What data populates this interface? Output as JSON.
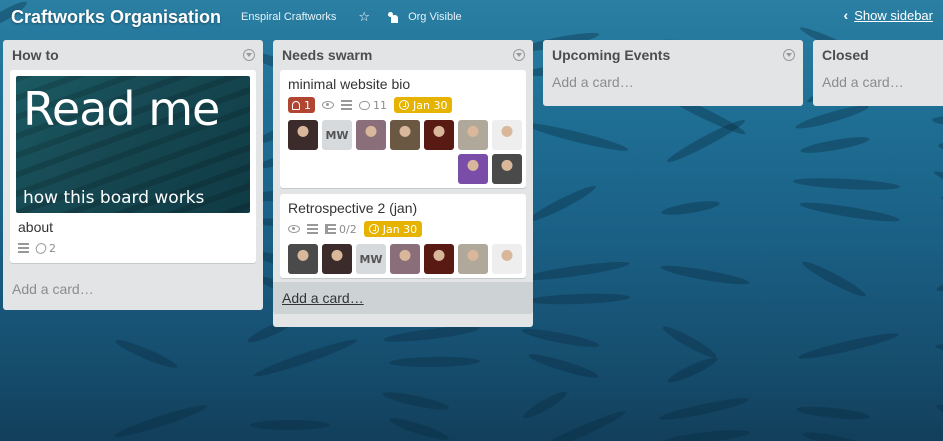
{
  "board": {
    "title": "Craftworks Organisation",
    "org": "Enspiral Craftworks",
    "visibility": "Org Visible",
    "show_sidebar": "Show sidebar"
  },
  "lists": [
    {
      "title": "How to",
      "cards": [
        {
          "cover_title": "Read me",
          "cover_subtitle": "how this board works",
          "title": "about",
          "attachments": "2"
        }
      ],
      "add_card": "Add a card…"
    },
    {
      "title": "Needs swarm",
      "cards": [
        {
          "title": "minimal website bio",
          "notifications": "1",
          "comments": "11",
          "due": "Jan 30",
          "members": [
            {
              "type": "photo",
              "color": "#3b2b2b"
            },
            {
              "type": "initials",
              "initials": "MW"
            },
            {
              "type": "photo",
              "color": "#8a6f7a"
            },
            {
              "type": "photo",
              "color": "#6b5842"
            },
            {
              "type": "photo",
              "color": "#5a1a14"
            },
            {
              "type": "photo",
              "color": "#b0a89a"
            },
            {
              "type": "photo",
              "color": "#eeeeee"
            },
            {
              "type": "photo",
              "color": "#7a4ea8"
            },
            {
              "type": "photo",
              "color": "#4a4a4a"
            }
          ]
        },
        {
          "title": "Retrospective 2 (jan)",
          "checklist": "0/2",
          "due": "Jan 30",
          "members": [
            {
              "type": "photo",
              "color": "#4a4a4a"
            },
            {
              "type": "photo",
              "color": "#3b2b2b"
            },
            {
              "type": "initials",
              "initials": "MW"
            },
            {
              "type": "photo",
              "color": "#8a6f7a"
            },
            {
              "type": "photo",
              "color": "#5a1a14"
            },
            {
              "type": "photo",
              "color": "#b0a89a"
            },
            {
              "type": "photo",
              "color": "#eeeeee"
            }
          ]
        }
      ],
      "add_card": "Add a card…"
    },
    {
      "title": "Upcoming Events",
      "cards": [],
      "add_card": "Add a card…"
    },
    {
      "title": "Closed",
      "cards": [],
      "add_card": "Add a card…"
    }
  ],
  "colors": {
    "list_bg": "#e2e4e6",
    "notification_badge": "#b04632",
    "due_badge": "#e6b400"
  }
}
